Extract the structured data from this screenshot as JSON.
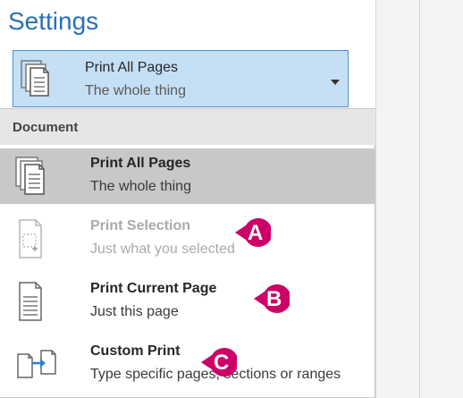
{
  "title": "Settings",
  "dropdown": {
    "title": "Print All Pages",
    "subtitle": "The whole thing",
    "icon": "pages-stack-icon"
  },
  "menu": {
    "header": "Document",
    "items": [
      {
        "title": "Print All Pages",
        "subtitle": "The whole thing",
        "icon": "pages-stack-icon",
        "selected": true,
        "enabled": true
      },
      {
        "title": "Print Selection",
        "subtitle": "Just what you selected",
        "icon": "selection-page-icon",
        "selected": false,
        "enabled": false
      },
      {
        "title": "Print Current Page",
        "subtitle": "Just this page",
        "icon": "single-page-icon",
        "selected": false,
        "enabled": true
      },
      {
        "title": "Custom Print",
        "subtitle": "Type specific pages, sections or ranges",
        "icon": "custom-print-icon",
        "selected": false,
        "enabled": true
      }
    ]
  },
  "callouts": [
    "A",
    "B",
    "C"
  ],
  "colors": {
    "accent": "#2a6fb8",
    "badge": "#cc0066",
    "dropdown_bg": "#c5dff5",
    "selected_bg": "#c8c8c8"
  }
}
